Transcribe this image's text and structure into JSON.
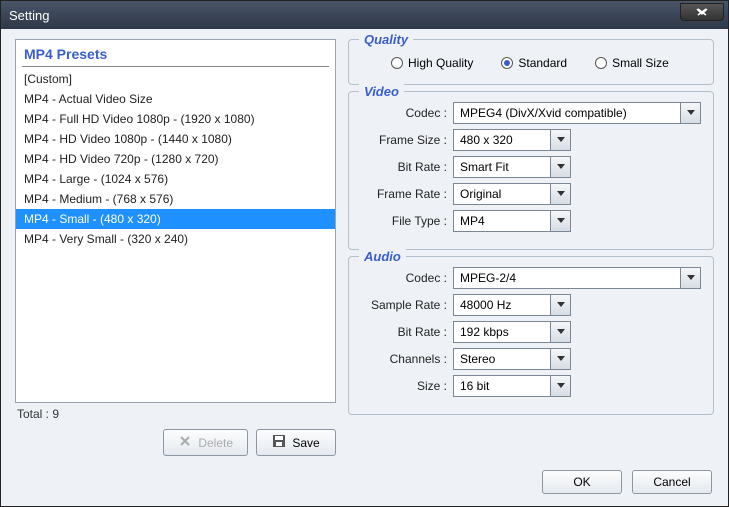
{
  "window": {
    "title": "Setting"
  },
  "presets": {
    "header": "MP4 Presets",
    "items": [
      "[Custom]",
      "MP4 - Actual Video Size",
      "MP4 - Full HD Video 1080p - (1920 x 1080)",
      "MP4 - HD Video 1080p - (1440 x 1080)",
      "MP4 - HD Video 720p - (1280 x 720)",
      "MP4 - Large - (1024 x 576)",
      "MP4 - Medium - (768 x 576)",
      "MP4 - Small - (480 x 320)",
      "MP4 - Very Small - (320 x 240)"
    ],
    "selected_index": 7,
    "total_label": "Total : 9"
  },
  "buttons": {
    "delete": "Delete",
    "save": "Save",
    "ok": "OK",
    "cancel": "Cancel"
  },
  "quality": {
    "group": "Quality",
    "options": [
      "High Quality",
      "Standard",
      "Small Size"
    ],
    "selected_index": 1
  },
  "video": {
    "group": "Video",
    "codec_label": "Codec :",
    "codec_value": "MPEG4 (DivX/Xvid compatible)",
    "frame_size_label": "Frame Size :",
    "frame_size_value": "480 x 320",
    "bit_rate_label": "Bit Rate :",
    "bit_rate_value": "Smart Fit",
    "frame_rate_label": "Frame Rate :",
    "frame_rate_value": "Original",
    "file_type_label": "File Type :",
    "file_type_value": "MP4"
  },
  "audio": {
    "group": "Audio",
    "codec_label": "Codec :",
    "codec_value": "MPEG-2/4",
    "sample_rate_label": "Sample Rate :",
    "sample_rate_value": "48000 Hz",
    "bit_rate_label": "Bit Rate :",
    "bit_rate_value": "192 kbps",
    "channels_label": "Channels :",
    "channels_value": "Stereo",
    "size_label": "Size :",
    "size_value": "16 bit"
  }
}
